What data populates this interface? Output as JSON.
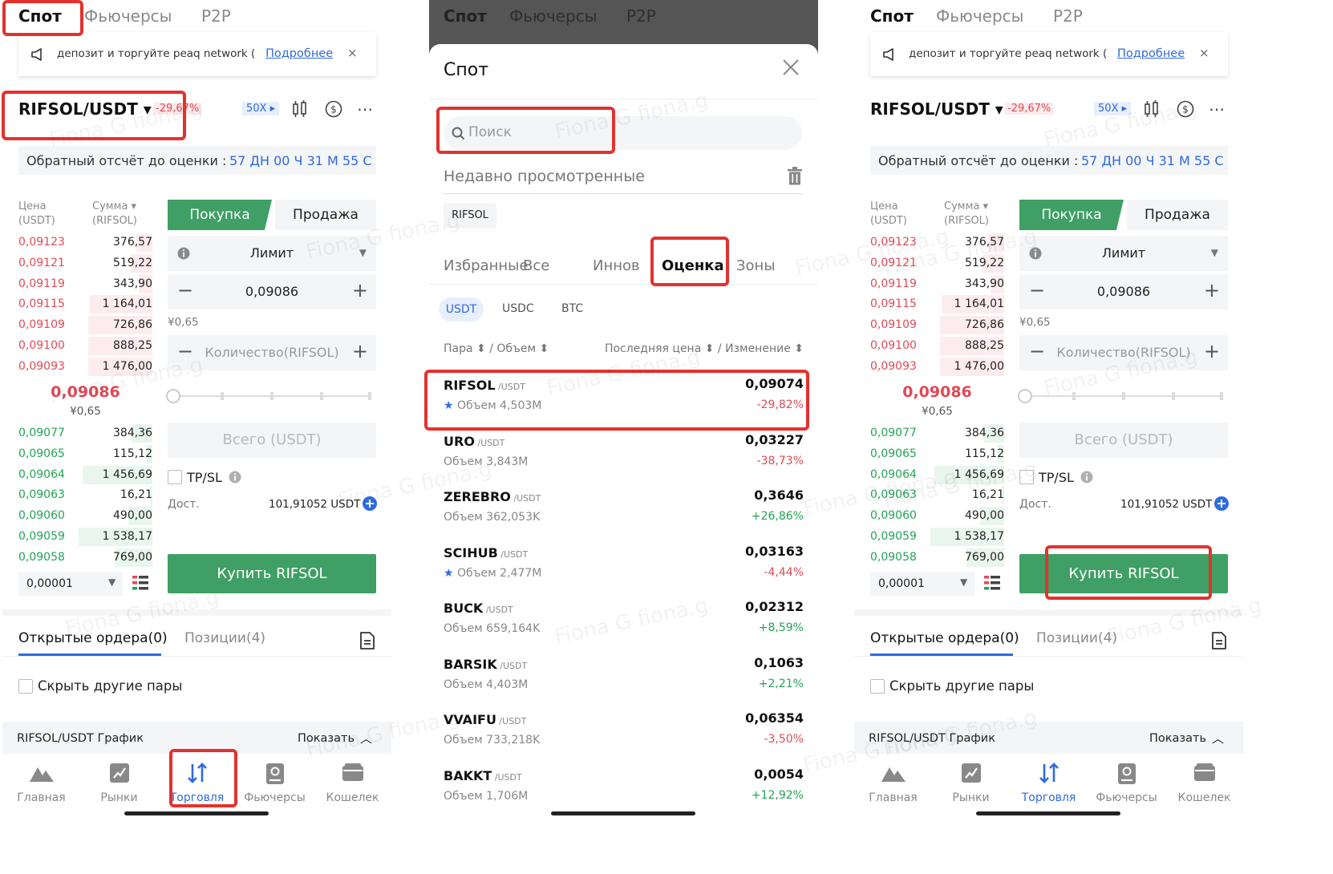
{
  "colors": {
    "buy": "#3f9f64",
    "sell": "#e04a55",
    "accent": "#2f6ae0",
    "highlight": "#e2322e"
  },
  "top_tabs": [
    "Спот",
    "Фьючерсы",
    "P2P"
  ],
  "banner": {
    "text": "депозит и торгуйте peaq network (",
    "link": "Подробнее",
    "close": "×"
  },
  "pair": {
    "name": "RIFSOL/USDT ▾",
    "change": "-29,67%",
    "leverage": "50X ▸"
  },
  "countdown": {
    "label": "Обратный отсчёт до оценки :",
    "value": "57 ДН 00 Ч 31 М 55 С"
  },
  "orderbook": {
    "price_header": "Цена\n(USDT)",
    "amount_header": "Сумма ▾\n(RIFSOL)",
    "asks": [
      {
        "price": "0,09123",
        "amount": "376,57",
        "depth": 0.12
      },
      {
        "price": "0,09121",
        "amount": "519,22",
        "depth": 0.16
      },
      {
        "price": "0,09119",
        "amount": "343,90",
        "depth": 0.1
      },
      {
        "price": "0,09115",
        "amount": "1 164,01",
        "depth": 0.47
      },
      {
        "price": "0,09109",
        "amount": "726,86",
        "depth": 0.48
      },
      {
        "price": "0,09100",
        "amount": "888,25",
        "depth": 0.48
      },
      {
        "price": "0,09093",
        "amount": "1 476,00",
        "depth": 0.48
      }
    ],
    "last_price": "0,09086",
    "last_cny": "¥0,65",
    "bids": [
      {
        "price": "0,09077",
        "amount": "384,36",
        "depth": 0.15
      },
      {
        "price": "0,09065",
        "amount": "115,12",
        "depth": 0.05
      },
      {
        "price": "0,09064",
        "amount": "1 456,69",
        "depth": 0.52
      },
      {
        "price": "0,09063",
        "amount": "16,21",
        "depth": 0.02
      },
      {
        "price": "0,09060",
        "amount": "490,00",
        "depth": 0.18
      },
      {
        "price": "0,09059",
        "amount": "1 538,17",
        "depth": 0.55
      },
      {
        "price": "0,09058",
        "amount": "769,00",
        "depth": 0.28
      }
    ],
    "step": "0,00001"
  },
  "trade": {
    "buy": "Покупка",
    "sell": "Продажа",
    "order_type": "Лимит",
    "price": "0,09086",
    "cny": "¥0,65",
    "qty_placeholder": "Количество(RIFSOL)",
    "total_placeholder": "Всего (USDT)",
    "tpsl": "TP/SL",
    "avail_label": "Дост.",
    "avail_value": "101,91052 USDT",
    "buy_button": "Купить RIFSOL"
  },
  "orders": {
    "tab_open": "Открытые ордера(0)",
    "tab_positions": "Позиции(4)",
    "hide_pairs": "Скрыть другие пары"
  },
  "chart_bar": {
    "label": "RIFSOL/USDT График",
    "show": "Показать"
  },
  "nav": [
    {
      "label": "Главная",
      "icon": "home-icon"
    },
    {
      "label": "Рынки",
      "icon": "markets-icon"
    },
    {
      "label": "Торговля",
      "icon": "trade-icon"
    },
    {
      "label": "Фьючерсы",
      "icon": "futures-icon"
    },
    {
      "label": "Кошелек",
      "icon": "wallet-icon"
    }
  ],
  "picker": {
    "title": "Спот",
    "search_placeholder": "Поиск",
    "recent_label": "Недавно просмотренные",
    "recent_chip": "RIFSOL",
    "categories": [
      "Избранные",
      "Все",
      "Иннов",
      "Оценка",
      "Зоны"
    ],
    "quotes": [
      "USDT",
      "USDC",
      "BTC"
    ],
    "col_left": "Пара ⬍ / Объем ⬍",
    "col_right": "Последняя цена ⬍ / Изменение ⬍",
    "rows": [
      {
        "sym": "RIFSOL",
        "quote": "/USDT",
        "vol": "Объем 4,503M",
        "star": true,
        "price": "0,09074",
        "change": "-29,82%",
        "up": false
      },
      {
        "sym": "URO",
        "quote": "/USDT",
        "vol": "Объем 3,843M",
        "star": false,
        "price": "0,03227",
        "change": "-38,73%",
        "up": false
      },
      {
        "sym": "ZEREBRO",
        "quote": "/USDT",
        "vol": "Объем 362,053K",
        "star": false,
        "price": "0,3646",
        "change": "+26,86%",
        "up": true
      },
      {
        "sym": "SCIHUB",
        "quote": "/USDT",
        "vol": "Объем 2,477M",
        "star": true,
        "price": "0,03163",
        "change": "-4,44%",
        "up": false
      },
      {
        "sym": "BUCK",
        "quote": "/USDT",
        "vol": "Объем 659,164K",
        "star": false,
        "price": "0,02312",
        "change": "+8,59%",
        "up": true
      },
      {
        "sym": "BARSIK",
        "quote": "/USDT",
        "vol": "Объем 4,403M",
        "star": false,
        "price": "0,1063",
        "change": "+2,21%",
        "up": true
      },
      {
        "sym": "VVAIFU",
        "quote": "/USDT",
        "vol": "Объем 733,218K",
        "star": false,
        "price": "0,06354",
        "change": "-3,50%",
        "up": false
      },
      {
        "sym": "BAKKT",
        "quote": "/USDT",
        "vol": "Объем 1,706M",
        "star": false,
        "price": "0,0054",
        "change": "+12,92%",
        "up": true
      }
    ]
  },
  "watermark": "Fiona G fiona.g"
}
